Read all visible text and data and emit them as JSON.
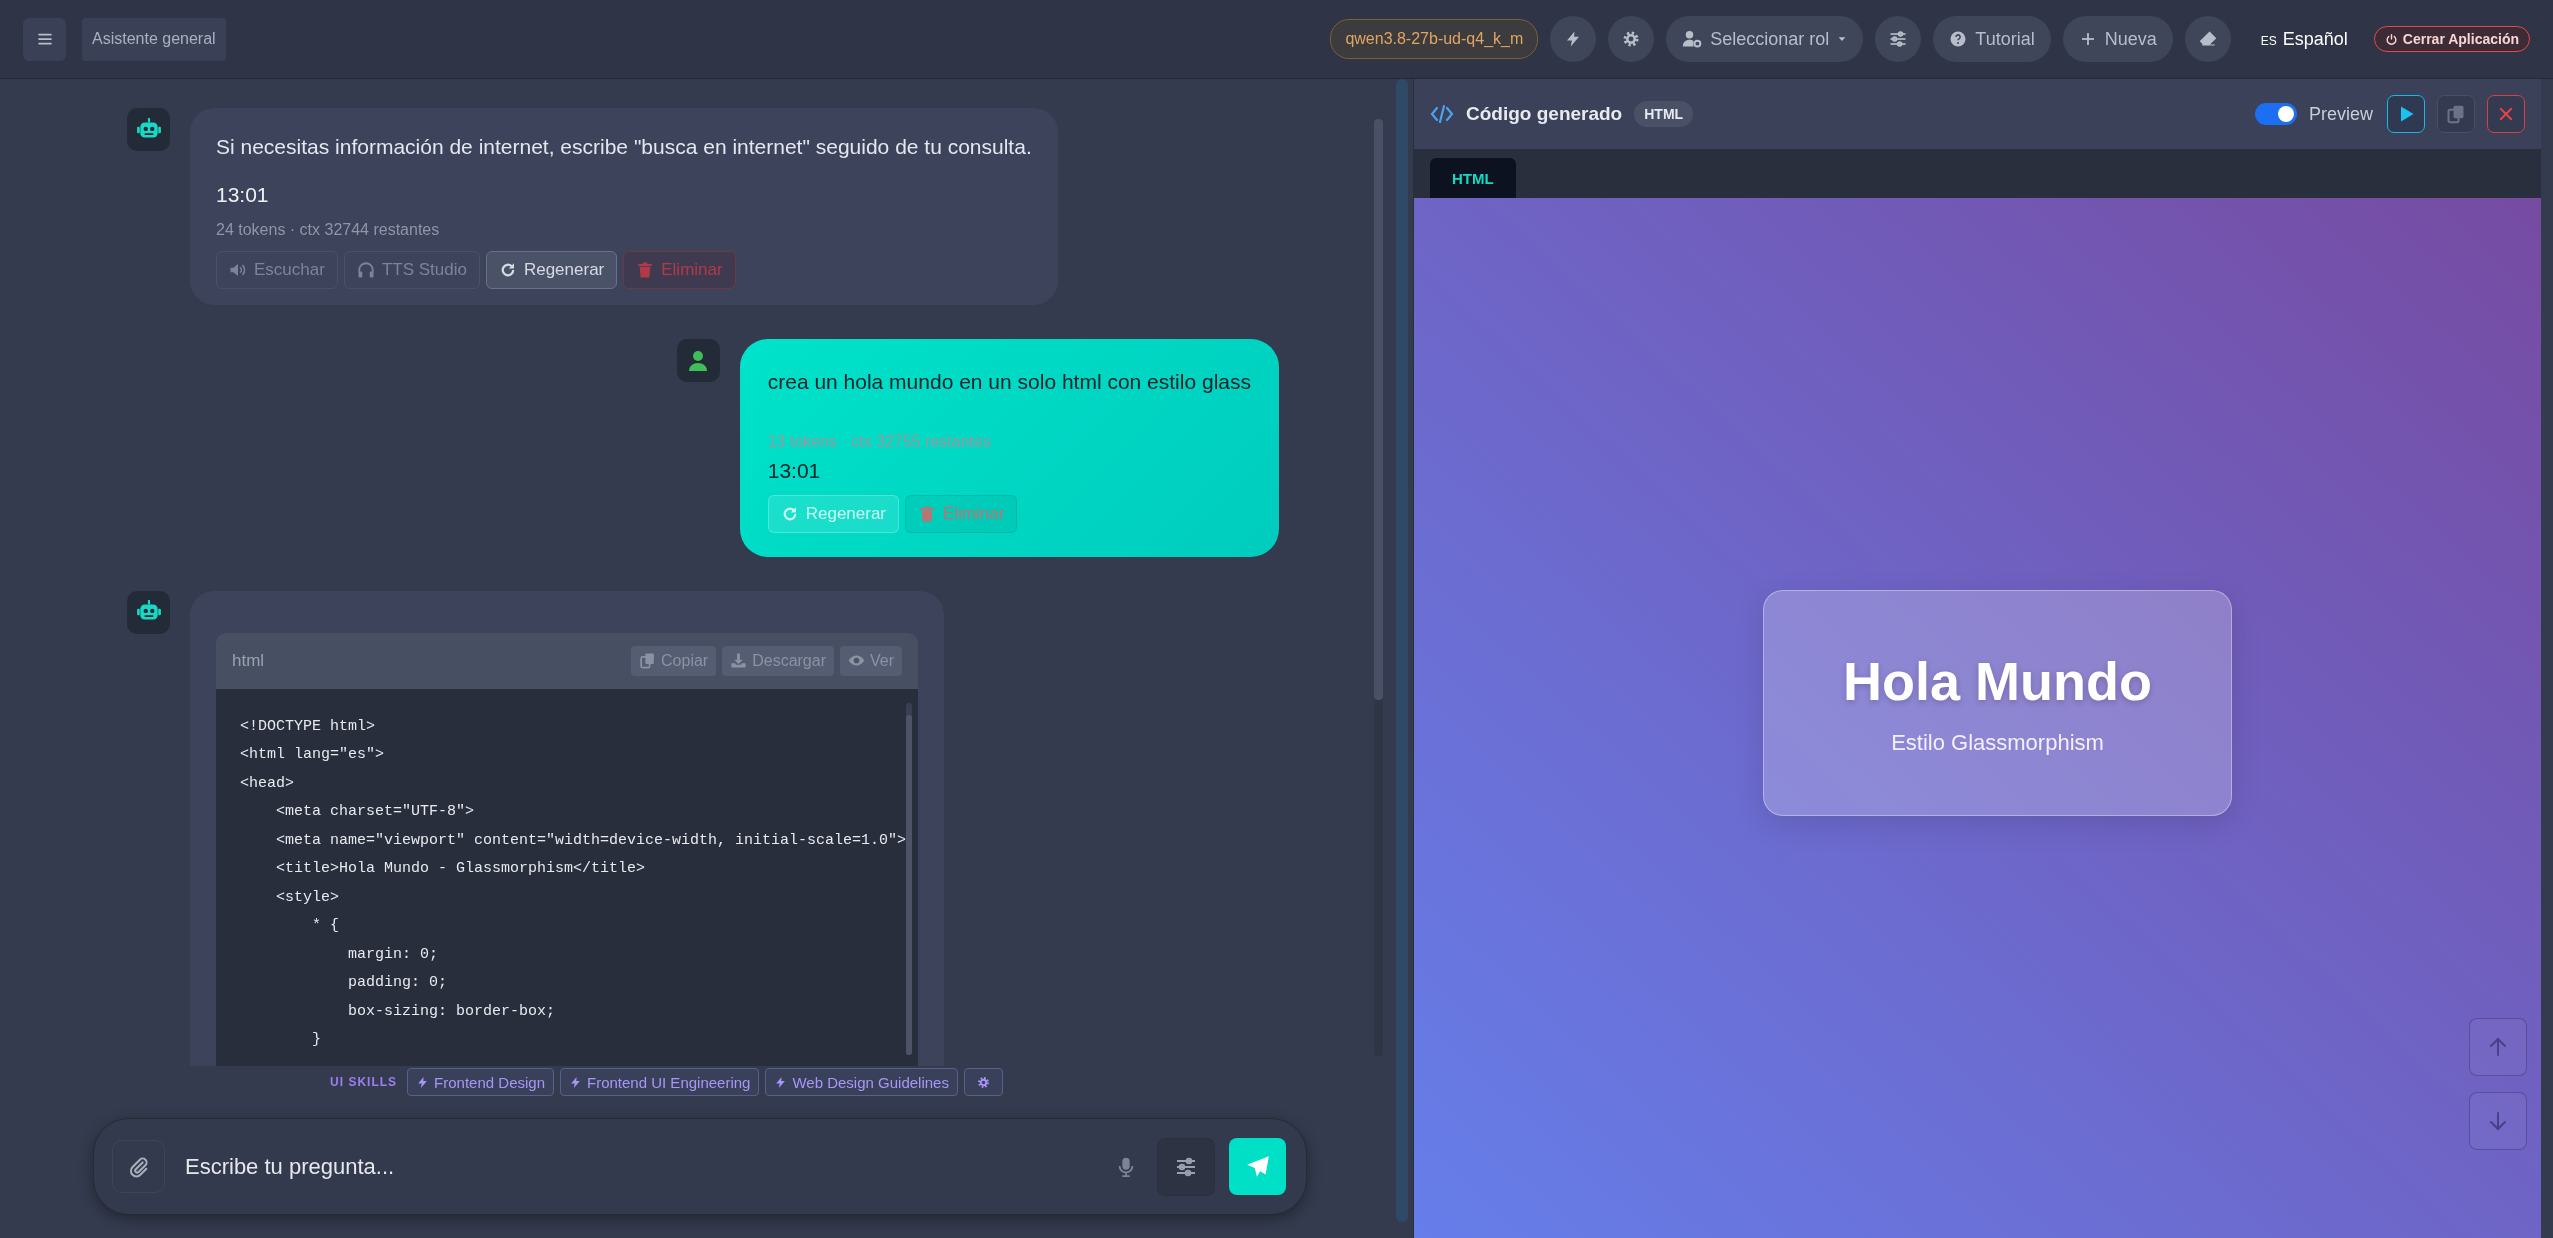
{
  "top_bar": {
    "assistant": "Asistente general",
    "model": "qwen3.8-27b-ud-q4_k_m",
    "role_button": "Seleccionar rol",
    "tutorial_button": "Tutorial",
    "new_button": "Nueva",
    "language": {
      "code": "ES",
      "label": "Español"
    },
    "close_button": "Cerrar Aplicación"
  },
  "messages": [
    {
      "kind": "bot",
      "text": "Si necesitas información de internet, escribe \"busca en internet\" seguido de tu consulta.",
      "time": "13:01",
      "meta": "24 tokens · ctx 32744 restantes",
      "actions": [
        {
          "kind": "listen",
          "label": "Escuchar"
        },
        {
          "kind": "tts",
          "label": "TTS Studio"
        },
        {
          "kind": "regenerate",
          "label": "Regenerar"
        },
        {
          "kind": "delete",
          "label": "Eliminar"
        }
      ]
    },
    {
      "kind": "user",
      "text": "crea un hola mundo en un solo html con estilo glass",
      "meta": "13 tokens · ctx 32755 restantes",
      "time": "13:01",
      "actions": [
        {
          "kind": "regenerate",
          "label": "Regenerar"
        },
        {
          "kind": "delete",
          "label": "Eliminar"
        }
      ]
    },
    {
      "kind": "bot_code",
      "code_block": {
        "language": "html",
        "buttons": [
          {
            "kind": "copy",
            "label": "Copiar"
          },
          {
            "kind": "download",
            "label": "Descargar"
          },
          {
            "kind": "view",
            "label": "Ver"
          }
        ],
        "lines": [
          "<!DOCTYPE html>",
          "<html lang=\"es\">",
          "<head>",
          "    <meta charset=\"UTF-8\">",
          "    <meta name=\"viewport\" content=\"width=device-width, initial-scale=1.0\">",
          "    <title>Hola Mundo - Glassmorphism</title>",
          "    <style>",
          "        * {",
          "            margin: 0;",
          "            padding: 0;",
          "            box-sizing: border-box;",
          "        }"
        ]
      }
    }
  ],
  "skills": {
    "label": "UI SKILLS",
    "items": [
      "Frontend Design",
      "Frontend UI Engineering",
      "Web Design Guidelines"
    ]
  },
  "composer": {
    "placeholder": "Escribe tu pregunta..."
  },
  "preview_panel": {
    "title": "Código generado",
    "badge": "HTML",
    "preview_toggle": {
      "label": "Preview",
      "on": true
    },
    "tabs": [
      {
        "label": "HTML",
        "selected": true
      }
    ],
    "preview": {
      "heading": "Hola Mundo",
      "subtitle": "Estilo Glassmorphism"
    }
  }
}
